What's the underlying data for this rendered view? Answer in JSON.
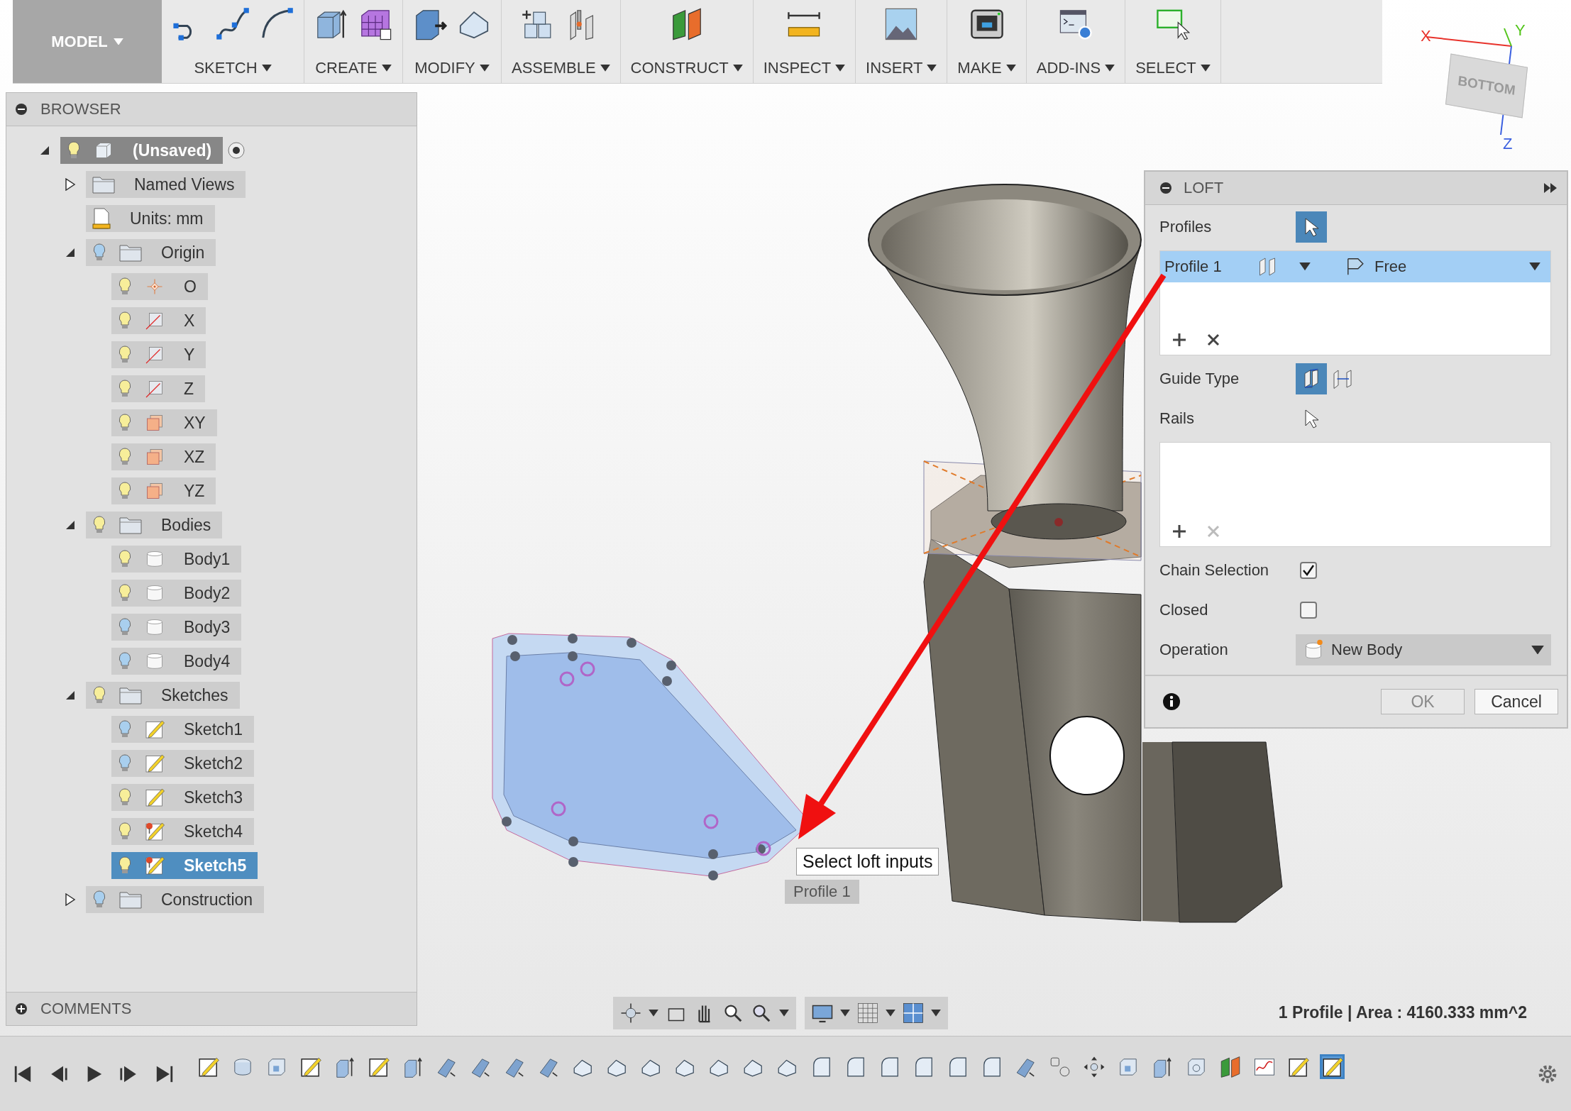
{
  "toolbar": {
    "mode": "MODEL",
    "groups": [
      {
        "label": "SKETCH"
      },
      {
        "label": "CREATE"
      },
      {
        "label": "MODIFY"
      },
      {
        "label": "ASSEMBLE"
      },
      {
        "label": "CONSTRUCT"
      },
      {
        "label": "INSPECT"
      },
      {
        "label": "INSERT"
      },
      {
        "label": "MAKE"
      },
      {
        "label": "ADD-INS"
      },
      {
        "label": "SELECT"
      }
    ]
  },
  "view_cube": {
    "face": "BOTTOM",
    "axes": [
      {
        "label": "X",
        "color": "#e8322b"
      },
      {
        "label": "Y",
        "color": "#52c41a"
      },
      {
        "label": "Z",
        "color": "#3a5fe0"
      }
    ]
  },
  "browser": {
    "title": "BROWSER",
    "items": [
      {
        "label": "(Unsaved)",
        "kind": "component",
        "visible": true,
        "active": true,
        "expanded": true,
        "selected": false,
        "children": [
          {
            "label": "Named Views",
            "kind": "folder",
            "expanded": false,
            "selected": false
          },
          {
            "label": "Units: mm",
            "kind": "units",
            "selected": false
          },
          {
            "label": "Origin",
            "kind": "folder",
            "visible": false,
            "expanded": true,
            "selected": false,
            "children": [
              {
                "label": "O",
                "kind": "point",
                "visible": true,
                "selected": false
              },
              {
                "label": "X",
                "kind": "axis",
                "visible": true,
                "selected": false
              },
              {
                "label": "Y",
                "kind": "axis",
                "visible": true,
                "selected": false
              },
              {
                "label": "Z",
                "kind": "axis",
                "visible": true,
                "selected": false
              },
              {
                "label": "XY",
                "kind": "plane",
                "visible": true,
                "selected": false
              },
              {
                "label": "XZ",
                "kind": "plane",
                "visible": true,
                "selected": false
              },
              {
                "label": "YZ",
                "kind": "plane",
                "visible": true,
                "selected": false
              }
            ]
          },
          {
            "label": "Bodies",
            "kind": "folder",
            "visible": true,
            "expanded": true,
            "selected": false,
            "children": [
              {
                "label": "Body1",
                "kind": "body",
                "visible": true,
                "selected": false
              },
              {
                "label": "Body2",
                "kind": "body",
                "visible": true,
                "selected": false
              },
              {
                "label": "Body3",
                "kind": "body",
                "visible": false,
                "selected": false
              },
              {
                "label": "Body4",
                "kind": "body",
                "visible": false,
                "selected": false
              }
            ]
          },
          {
            "label": "Sketches",
            "kind": "folder",
            "visible": true,
            "expanded": true,
            "selected": false,
            "children": [
              {
                "label": "Sketch1",
                "kind": "sketch",
                "visible": false,
                "selected": false
              },
              {
                "label": "Sketch2",
                "kind": "sketch",
                "visible": false,
                "selected": false
              },
              {
                "label": "Sketch3",
                "kind": "sketch",
                "visible": true,
                "selected": false
              },
              {
                "label": "Sketch4",
                "kind": "pinned-sketch",
                "visible": true,
                "selected": false
              },
              {
                "label": "Sketch5",
                "kind": "pinned-sketch",
                "visible": true,
                "selected": true
              }
            ]
          },
          {
            "label": "Construction",
            "kind": "folder",
            "visible": false,
            "expanded": false,
            "selected": false
          }
        ]
      }
    ]
  },
  "comments": {
    "title": "COMMENTS"
  },
  "canvas": {
    "profile_tag": "Profile 1",
    "tooltip": "Select loft inputs"
  },
  "status": "1 Profile | Area : 4160.333 mm^2",
  "loft": {
    "title": "LOFT",
    "profiles_label": "Profiles",
    "profiles": [
      {
        "label": "Profile 1",
        "end_condition": "Free",
        "selected": true
      }
    ],
    "profiles_remove_disabled": false,
    "guide_type_label": "Guide Type",
    "guide_types": [
      {
        "kind": "rails",
        "selected": true
      },
      {
        "kind": "centerline",
        "selected": false
      }
    ],
    "rails_label": "Rails",
    "rails_remove_disabled": true,
    "options": [
      {
        "label": "Chain Selection",
        "checked": true
      },
      {
        "label": "Closed",
        "checked": false
      }
    ],
    "operation": {
      "label": "Operation",
      "value": "New Body"
    },
    "buttons": [
      {
        "label": "OK",
        "disabled": true
      },
      {
        "label": "Cancel",
        "disabled": false
      }
    ]
  },
  "timeline": [
    {
      "kind": "sketch",
      "selected": false
    },
    {
      "kind": "revolve",
      "selected": false
    },
    {
      "kind": "box",
      "selected": false
    },
    {
      "kind": "sketch",
      "selected": false
    },
    {
      "kind": "extrude",
      "selected": false
    },
    {
      "kind": "sketch",
      "selected": false
    },
    {
      "kind": "extrude",
      "selected": false
    },
    {
      "kind": "sweep",
      "selected": false
    },
    {
      "kind": "sweep",
      "selected": false
    },
    {
      "kind": "sweep",
      "selected": false
    },
    {
      "kind": "sweep",
      "selected": false
    },
    {
      "kind": "chamfer",
      "selected": false
    },
    {
      "kind": "chamfer",
      "selected": false
    },
    {
      "kind": "chamfer",
      "selected": false
    },
    {
      "kind": "chamfer",
      "selected": false
    },
    {
      "kind": "chamfer",
      "selected": false
    },
    {
      "kind": "chamfer",
      "selected": false
    },
    {
      "kind": "chamfer",
      "selected": false
    },
    {
      "kind": "fillet",
      "selected": false
    },
    {
      "kind": "fillet",
      "selected": false
    },
    {
      "kind": "fillet",
      "selected": false
    },
    {
      "kind": "fillet",
      "selected": false
    },
    {
      "kind": "fillet",
      "selected": false
    },
    {
      "kind": "fillet",
      "selected": false
    },
    {
      "kind": "sweep",
      "selected": false
    },
    {
      "kind": "joint",
      "selected": false
    },
    {
      "kind": "move",
      "selected": false
    },
    {
      "kind": "box",
      "selected": false
    },
    {
      "kind": "extrude",
      "selected": false
    },
    {
      "kind": "shell",
      "selected": false
    },
    {
      "kind": "plane",
      "selected": false
    },
    {
      "kind": "spline",
      "selected": false
    },
    {
      "kind": "sketch",
      "selected": false
    },
    {
      "kind": "sketch",
      "selected": true
    }
  ]
}
